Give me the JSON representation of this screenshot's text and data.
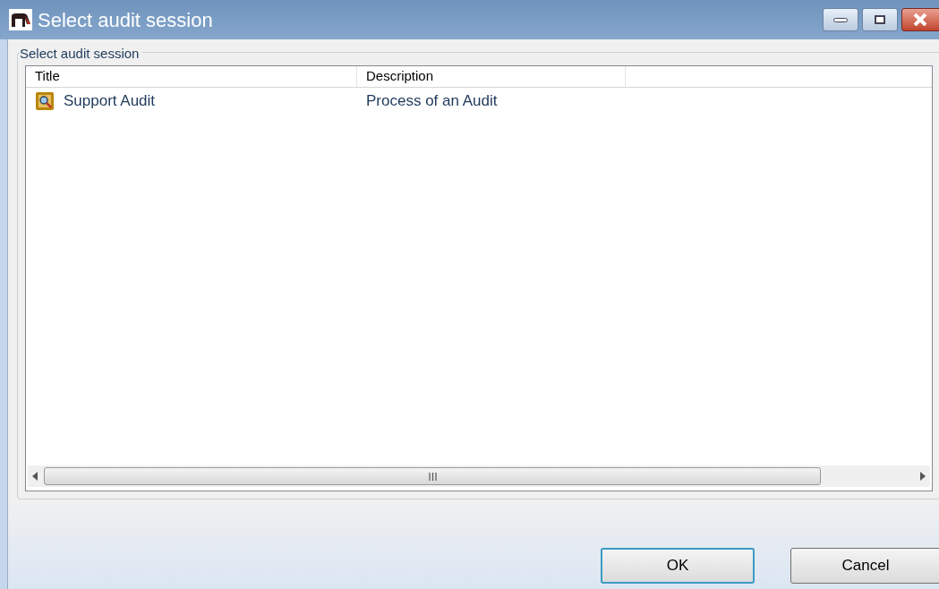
{
  "window": {
    "title": "Select audit session"
  },
  "group": {
    "label": "Select audit session"
  },
  "table": {
    "columns": [
      "Title",
      "Description"
    ],
    "rows": [
      {
        "title": "Support Audit",
        "description": "Process of an Audit"
      }
    ]
  },
  "buttons": [
    {
      "label": "OK",
      "default": true
    },
    {
      "label": "Cancel",
      "default": false
    }
  ]
}
